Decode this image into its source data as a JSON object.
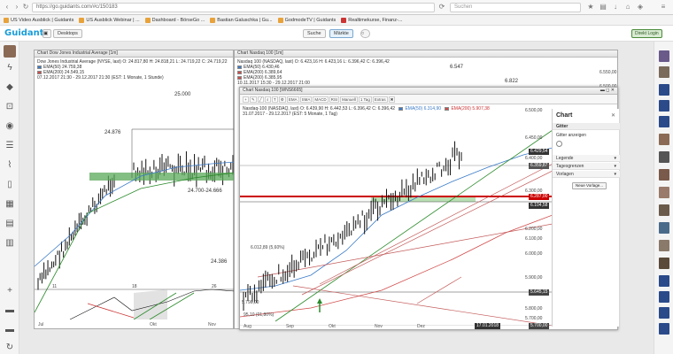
{
  "browser": {
    "url": "https://go.guidants.com/#c/150183",
    "search_placeholder": "Suchen",
    "bookmarks": [
      "US Video Ausblick | Guidants",
      "US Ausblick Webinar | ...",
      "Dashboard - BörseGo ...",
      "Bastian Galuschka | Gu...",
      "GodmodeTV | Guidants",
      "Realtimekurse, Finanz-..."
    ]
  },
  "app": {
    "logo": "Guidants",
    "desktops_label": "Desktops",
    "search_label": "Suche",
    "market_label": "Märkte",
    "login_label": "Direkt Login"
  },
  "dow_chart": {
    "title": "Chart Dow Jones Industrial Average [1m]",
    "legend": [
      "Dow Jones Industrial Average (NYSE, last)  O: 24.817,80  H: 24.818,21  L: 24.719,22  C: 24.719,22",
      "EMA(50)  24.759,38",
      "EMA(200)  24.549,15",
      "07.12.2017 21:30 - 29.12.2017 21:30  (EST: 1 Monate, 1 Stunde)"
    ],
    "labels": {
      "l25000": "25.000",
      "l24876": "24.876",
      "range": "24.700-24.666",
      "l24386": "24.386",
      "n11": "11",
      "n18": "18",
      "n26": "26"
    },
    "x_axis": [
      "Jul",
      "Okt",
      "Nov"
    ]
  },
  "nasdaq_bg": {
    "title": "Chart Nasdaq 100 [1m]",
    "legend": [
      "Nasdaq 100 (NASDAQ, last)  O: 6.423,16  H: 6.423,16  L: 6.396,42  C: 6.396,42",
      "EMA(50)  6.430,46",
      "EMA(200)  6.389,64",
      "EMA(200)  6.385,95",
      "10.11.2017 15:30 - 29.12.2017 21:00"
    ],
    "labels": {
      "l6547": "6.547",
      "l6822": "6.822"
    },
    "axis": [
      "6.550,00",
      "6.500,00"
    ]
  },
  "nasdaq_chart": {
    "title": "Chart Nasdaq 100 [WNS6665]",
    "toolbar": [
      "EMA",
      "SMA",
      "MACD",
      "RSI",
      "Manuell",
      "1 Tag",
      "Extras"
    ],
    "legend_line1": "Nasdaq-100 (NASDAQ, last)  O: 6.439,90  H: 6.442,53  L: 6.396,42  C: 6.396,42",
    "ema50": "EMA(50)  6.314,90",
    "ema200": "EMA(200)  5.907,38",
    "legend_line2": "31.07.2017 - 29.12.2017  (EST: 5 Monate, 1 Tag)",
    "axis": [
      "6.500,00",
      "6.450,00",
      "6.400,00",
      "6.300,00",
      "6.200,00",
      "6.100,00",
      "6.000,00",
      "5.900,00",
      "5.800,00",
      "5.700,00"
    ],
    "tags": {
      "t1": "6.429,54",
      "t2": "6.359,87",
      "t3": "6.287,00",
      "t4": "6.104,58",
      "t5": "5.645,15",
      "t6": "5.700,00"
    },
    "pct_label": "6.012,89 (5,60%)",
    "low_label": "95,10 (01,80%)",
    "low_price": "5.790,00",
    "x_axis": [
      "Aug",
      "Sep",
      "Okt",
      "Nov",
      "Dez"
    ],
    "date_tag": "17.01.2018"
  },
  "chart_panel": {
    "title": "Chart",
    "sections": [
      "Gitter",
      "Gitter anzeigen",
      "Legende",
      "Tagesgrenzen",
      "Vorlagen"
    ],
    "button": "Neue Vorlage..."
  },
  "colors": {
    "accent": "#1a9cd8",
    "support_zone": "#5aa85a",
    "resistance": "#cc0000"
  }
}
